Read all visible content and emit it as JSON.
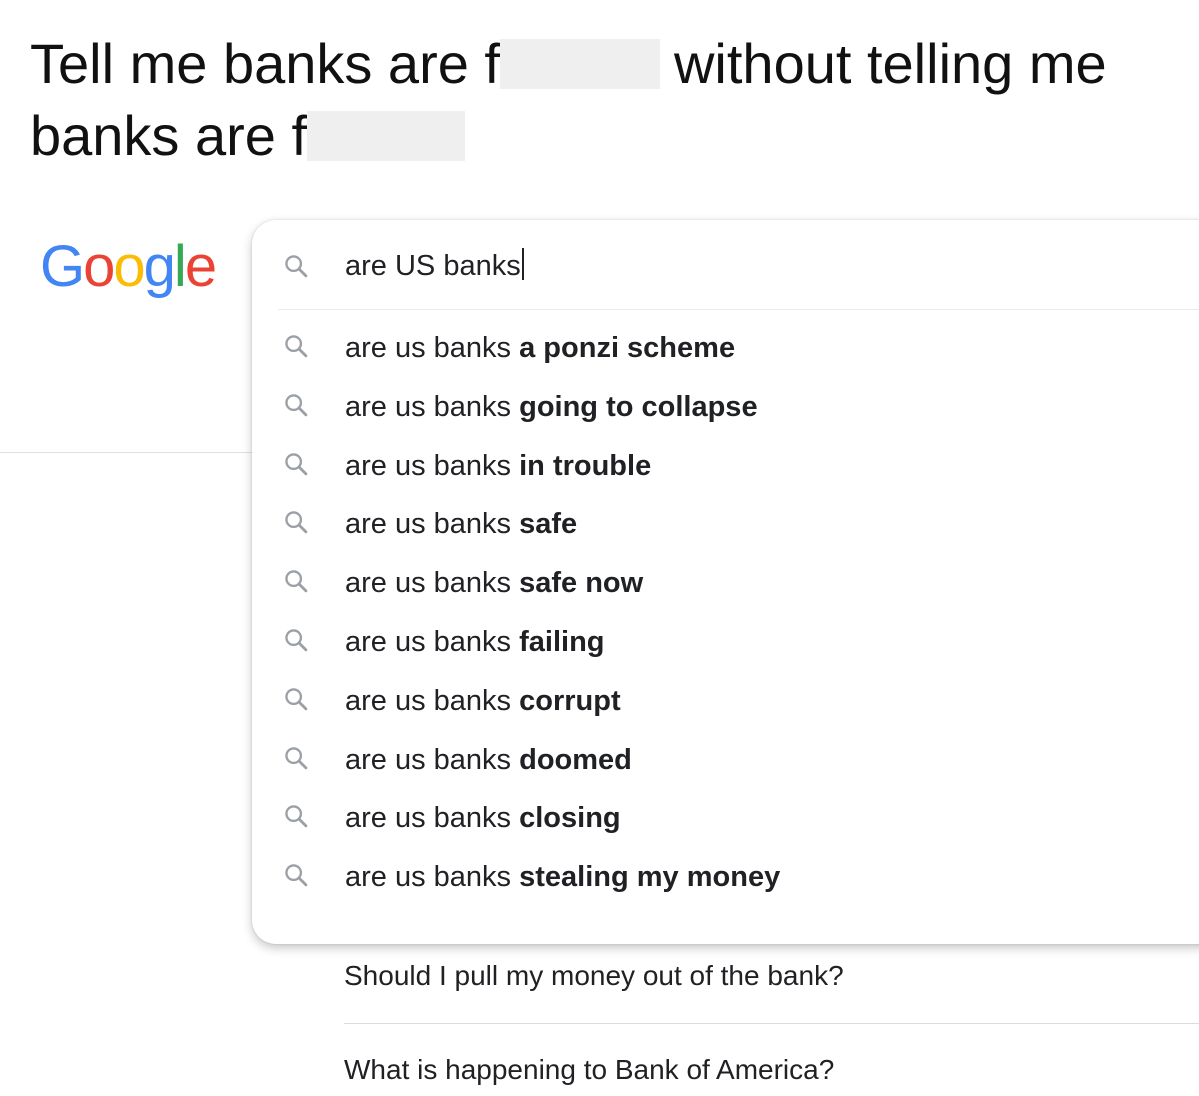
{
  "caption": {
    "line1_part1": "Tell me banks are f",
    "line1_part2": "without telling me",
    "line2_part1": "banks are f"
  },
  "logo": {
    "letters": [
      "G",
      "o",
      "o",
      "g",
      "l",
      "e"
    ],
    "colors": [
      "#4285F4",
      "#EA4335",
      "#FBBC05",
      "#4285F4",
      "#34A853",
      "#EA4335"
    ]
  },
  "search": {
    "query": "are US banks",
    "icon": "search-icon"
  },
  "suggestions": [
    {
      "prefix": "are us banks",
      "completion": "a ponzi scheme"
    },
    {
      "prefix": "are us banks",
      "completion": "going to collapse"
    },
    {
      "prefix": "are us banks",
      "completion": "in trouble"
    },
    {
      "prefix": "are us banks",
      "completion": "safe"
    },
    {
      "prefix": "are us banks",
      "completion": "safe now"
    },
    {
      "prefix": "are us banks",
      "completion": "failing"
    },
    {
      "prefix": "are us banks",
      "completion": "corrupt"
    },
    {
      "prefix": "are us banks",
      "completion": "doomed"
    },
    {
      "prefix": "are us banks",
      "completion": "closing"
    },
    {
      "prefix": "are us banks",
      "completion": "stealing my money"
    }
  ],
  "people_also_ask": [
    "Should I pull my money out of the bank?",
    "What is happening to Bank of America?"
  ]
}
